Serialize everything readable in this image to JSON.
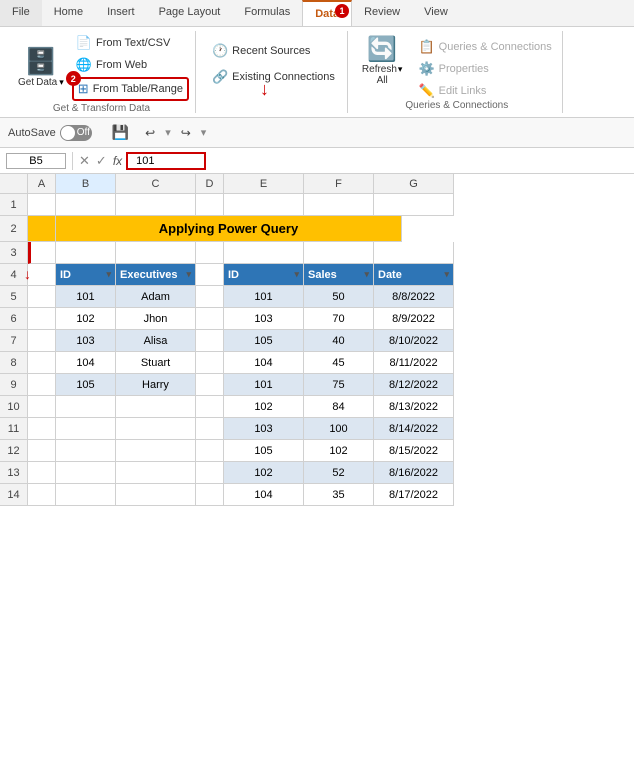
{
  "ribbon": {
    "tabs": [
      "File",
      "Home",
      "Insert",
      "Page Layout",
      "Formulas",
      "Data",
      "Review",
      "View"
    ],
    "active_tab": "Data",
    "groups": {
      "get_data": {
        "label": "Get & Transform Data",
        "btn_label": "Get\nData",
        "from_text_csv": "From Text/CSV",
        "from_web": "From Web",
        "from_table_range": "From Table/Range"
      },
      "sources": {
        "recent_sources": "Recent Sources",
        "existing_connections": "Existing Connections"
      },
      "refresh": {
        "label": "Queries & Connections",
        "refresh_all": "Refresh\nAll",
        "queries_connections": "Queries & Connections",
        "properties": "Properties",
        "edit_links": "Edit Links"
      }
    }
  },
  "toolbar": {
    "autosave": "AutoSave",
    "off": "Off",
    "undo": "↩",
    "redo": "↪"
  },
  "formula_bar": {
    "cell_ref": "B5",
    "value": "101",
    "fx": "fx"
  },
  "columns": {
    "left": [
      "A",
      "B",
      "C",
      "D"
    ],
    "right": [
      "E",
      "F",
      "G"
    ],
    "widths": [
      28,
      60,
      80,
      28,
      80,
      70,
      80
    ]
  },
  "rows": {
    "count": 14
  },
  "title": "Applying Power Query",
  "table1": {
    "headers": [
      "ID",
      "Executives"
    ],
    "rows": [
      {
        "id": 101,
        "exec": "Adam"
      },
      {
        "id": 102,
        "exec": "Jhon"
      },
      {
        "id": 103,
        "exec": "Alisa"
      },
      {
        "id": 104,
        "exec": "Stuart"
      },
      {
        "id": 105,
        "exec": "Harry"
      }
    ]
  },
  "table2": {
    "headers": [
      "ID",
      "Sales",
      "Date"
    ],
    "rows": [
      {
        "id": 101,
        "sales": 50,
        "date": "8/8/2022"
      },
      {
        "id": 103,
        "sales": 70,
        "date": "8/9/2022"
      },
      {
        "id": 105,
        "sales": 40,
        "date": "8/10/2022"
      },
      {
        "id": 104,
        "sales": 45,
        "date": "8/11/2022"
      },
      {
        "id": 101,
        "sales": 75,
        "date": "8/12/2022"
      },
      {
        "id": 102,
        "sales": 84,
        "date": "8/13/2022"
      },
      {
        "id": 103,
        "sales": 100,
        "date": "8/14/2022"
      },
      {
        "id": 105,
        "sales": 102,
        "date": "8/15/2022"
      },
      {
        "id": 102,
        "sales": 52,
        "date": "8/16/2022"
      },
      {
        "id": 104,
        "sales": 35,
        "date": "8/17/2022"
      }
    ]
  },
  "badges": {
    "data_tab": "1",
    "from_table": "2"
  },
  "colors": {
    "accent_red": "#c00000",
    "table_header": "#2e75b6",
    "table_odd": "#dce6f1",
    "title_bg": "#ffc000",
    "active_tab": "#c55a11"
  }
}
